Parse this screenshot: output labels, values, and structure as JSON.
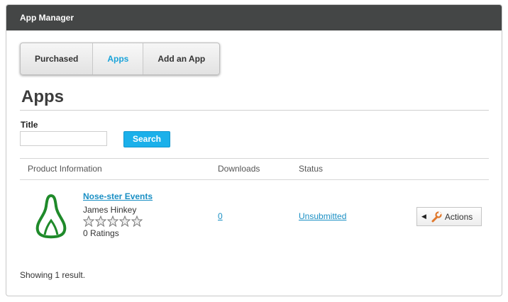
{
  "header": {
    "title": "App Manager"
  },
  "tabs": [
    {
      "label": "Purchased"
    },
    {
      "label": "Apps"
    },
    {
      "label": "Add an App"
    }
  ],
  "page": {
    "title": "Apps"
  },
  "search": {
    "label": "Title",
    "value": "",
    "button_label": "Search"
  },
  "table": {
    "columns": [
      "Product Information",
      "Downloads",
      "Status"
    ],
    "rows": [
      {
        "name": "Nose-ster Events",
        "author": "James Hinkey",
        "rating_stars": 0,
        "ratings_text": "0 Ratings",
        "downloads": "0",
        "status": "Unsubmitted",
        "actions_label": "Actions"
      }
    ]
  },
  "footer": {
    "summary": "Showing 1 result."
  },
  "colors": {
    "header_bg": "#444646",
    "accent": "#1bb0ea",
    "link": "#1a8fc4",
    "icon_green": "#1f8a2a"
  },
  "icons": {
    "app": "pear-icon",
    "actions": "wrench-icon",
    "caret": "caret-left-icon",
    "star": "star-outline-icon"
  }
}
